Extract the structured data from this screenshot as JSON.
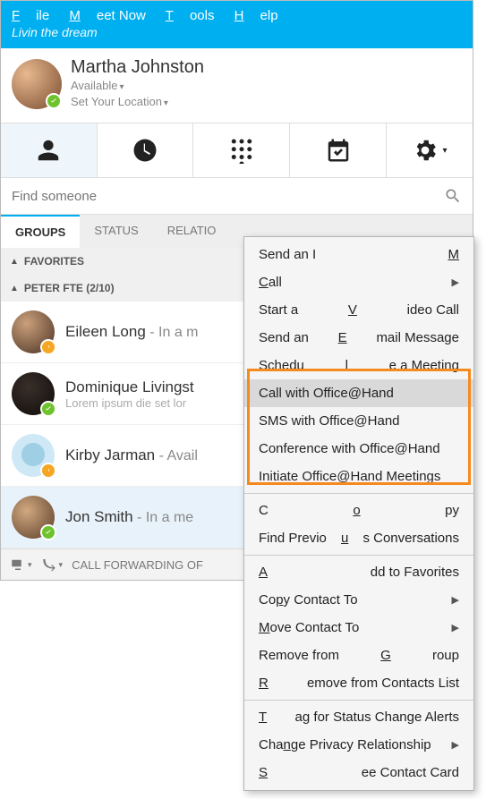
{
  "menubar": {
    "file": "File",
    "meetnow": "Meet Now",
    "tools": "Tools",
    "help": "Help"
  },
  "status_message": "Livin the dream",
  "profile": {
    "name": "Martha Johnston",
    "presence": "Available",
    "location": "Set Your Location"
  },
  "search": {
    "placeholder": "Find someone"
  },
  "filter_tabs": {
    "groups": "GROUPS",
    "status": "STATUS",
    "relations": "RELATIO"
  },
  "groups": {
    "favorites": "FAVORITES",
    "peter": "PETER FTE (2/10)"
  },
  "contacts": [
    {
      "name": "Eileen Long",
      "status": " - In a m",
      "sub": "",
      "presence": "away"
    },
    {
      "name": "Dominique Livingst",
      "status": "",
      "sub": "Lorem ipsum die set lor",
      "presence": "avail"
    },
    {
      "name": "Kirby Jarman",
      "status": " - Avail",
      "sub": "",
      "presence": "away"
    },
    {
      "name": "Jon Smith",
      "status": " - In a me",
      "sub": "",
      "presence": "avail"
    }
  ],
  "bottombar": {
    "text": "CALL FORWARDING OF"
  },
  "context_menu": {
    "send_im": "Send an IM",
    "call": "Call",
    "video": "Start a Video Call",
    "email": "Send an Email Message",
    "schedule": "Schedule a Meeting",
    "call_oah": "Call with Office@Hand",
    "sms_oah": "SMS with Office@Hand",
    "conf_oah": "Conference with Office@Hand",
    "init_oah": "Initiate Office@Hand Meetings",
    "copy": "Copy",
    "find_prev": "Find Previous Conversations",
    "add_fav": "Add to Favorites",
    "copy_to": "Copy Contact To",
    "move_to": "Move Contact To",
    "rm_group": "Remove from Group",
    "rm_list": "Remove from Contacts List",
    "tag": "Tag for Status Change Alerts",
    "privacy": "Change Privacy Relationship",
    "see_card": "See Contact Card"
  }
}
